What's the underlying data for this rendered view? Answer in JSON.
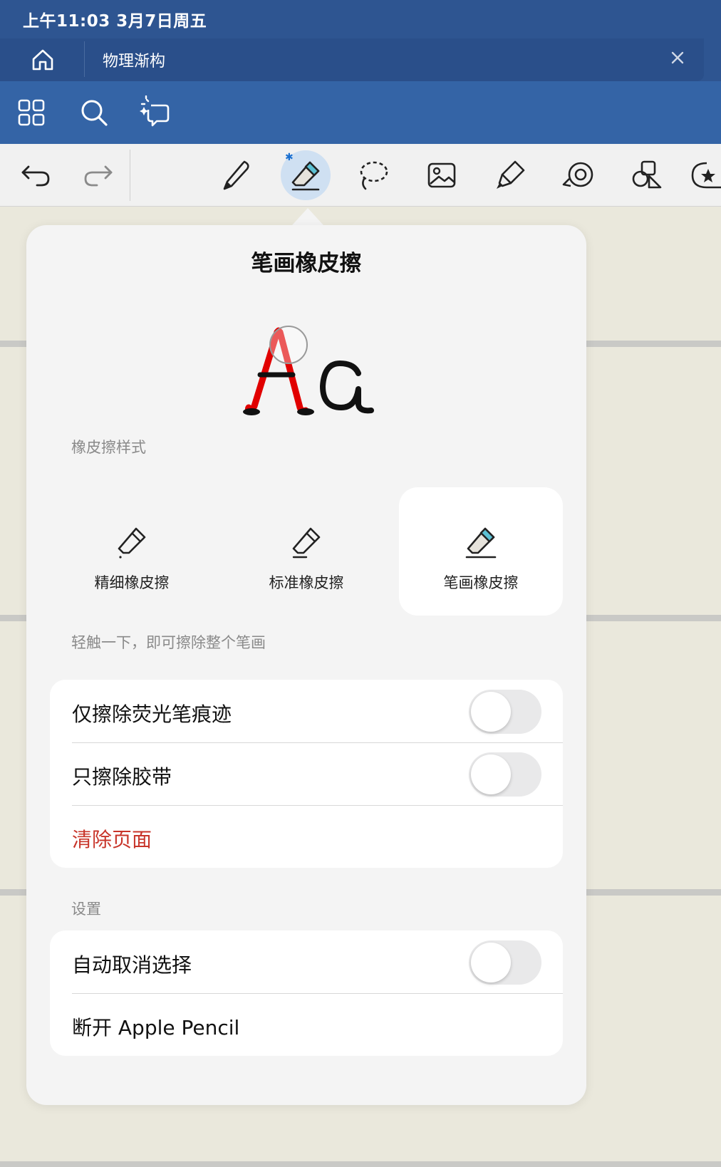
{
  "status_bar": {
    "time": "上午11:03   3月7日周五"
  },
  "tab": {
    "title": "物理渐构"
  },
  "popover": {
    "title": "笔画橡皮擦",
    "style_section_label": "橡皮擦样式",
    "style_options": [
      {
        "label": "精细橡皮擦",
        "selected": false
      },
      {
        "label": "标准橡皮擦",
        "selected": false
      },
      {
        "label": "笔画橡皮擦",
        "selected": true
      }
    ],
    "style_hint": "轻触一下，即可擦除整个笔画",
    "eraser_options": [
      {
        "label": "仅擦除荧光笔痕迹",
        "toggle": false
      },
      {
        "label": "只擦除胶带",
        "toggle": false
      },
      {
        "label": "清除页面"
      }
    ],
    "settings_label": "设置",
    "settings": [
      {
        "label": "自动取消选择",
        "toggle": false
      },
      {
        "label": "断开 Apple Pencil"
      }
    ]
  },
  "colors": {
    "accent_blue": "#3464a6",
    "danger": "#c8352a",
    "eraser_tip": "#5bc0d3"
  },
  "toolbar": {
    "active_tool": "stroke-eraser",
    "bluetooth_glyph": "✱"
  }
}
